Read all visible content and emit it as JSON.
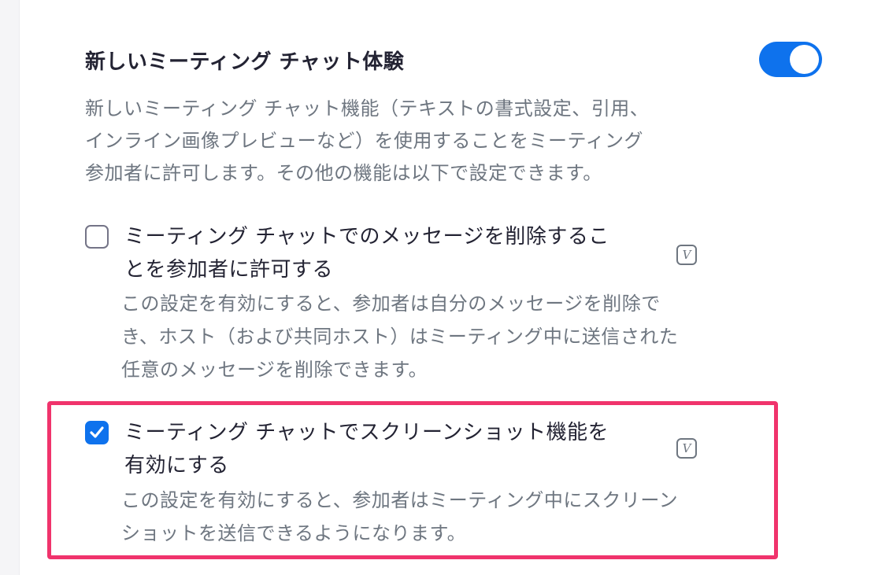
{
  "setting": {
    "title": "新しいミーティング チャット体験",
    "toggle_on": true,
    "description_lines": [
      "新しいミーティング チャット機能（テキストの書式設定、引用、",
      "インライン画像プレビューなど）を使用することをミーティング",
      "参加者に許可します。その他の機能は以下で設定できます。"
    ]
  },
  "options": [
    {
      "checked": false,
      "label_lines": [
        "ミーティング チャットでのメッセージを削除するこ",
        "とを参加者に許可する"
      ],
      "description_lines": [
        "この設定を有効にすると、参加者は自分のメッセージを削除で",
        "き、ホスト（および共同ホスト）はミーティング中に送信された",
        "任意のメッセージを削除できます。"
      ],
      "icon": "version-v-icon"
    },
    {
      "checked": true,
      "highlighted": true,
      "label_lines": [
        "ミーティング チャットでスクリーンショット機能を",
        "有効にする"
      ],
      "description_lines": [
        "この設定を有効にすると、参加者はミーティング中にスクリーン",
        "ショットを送信できるようになります。"
      ],
      "icon": "version-v-icon"
    }
  ],
  "colors": {
    "accent": "#0e72ed",
    "highlight": "#f0336c"
  }
}
